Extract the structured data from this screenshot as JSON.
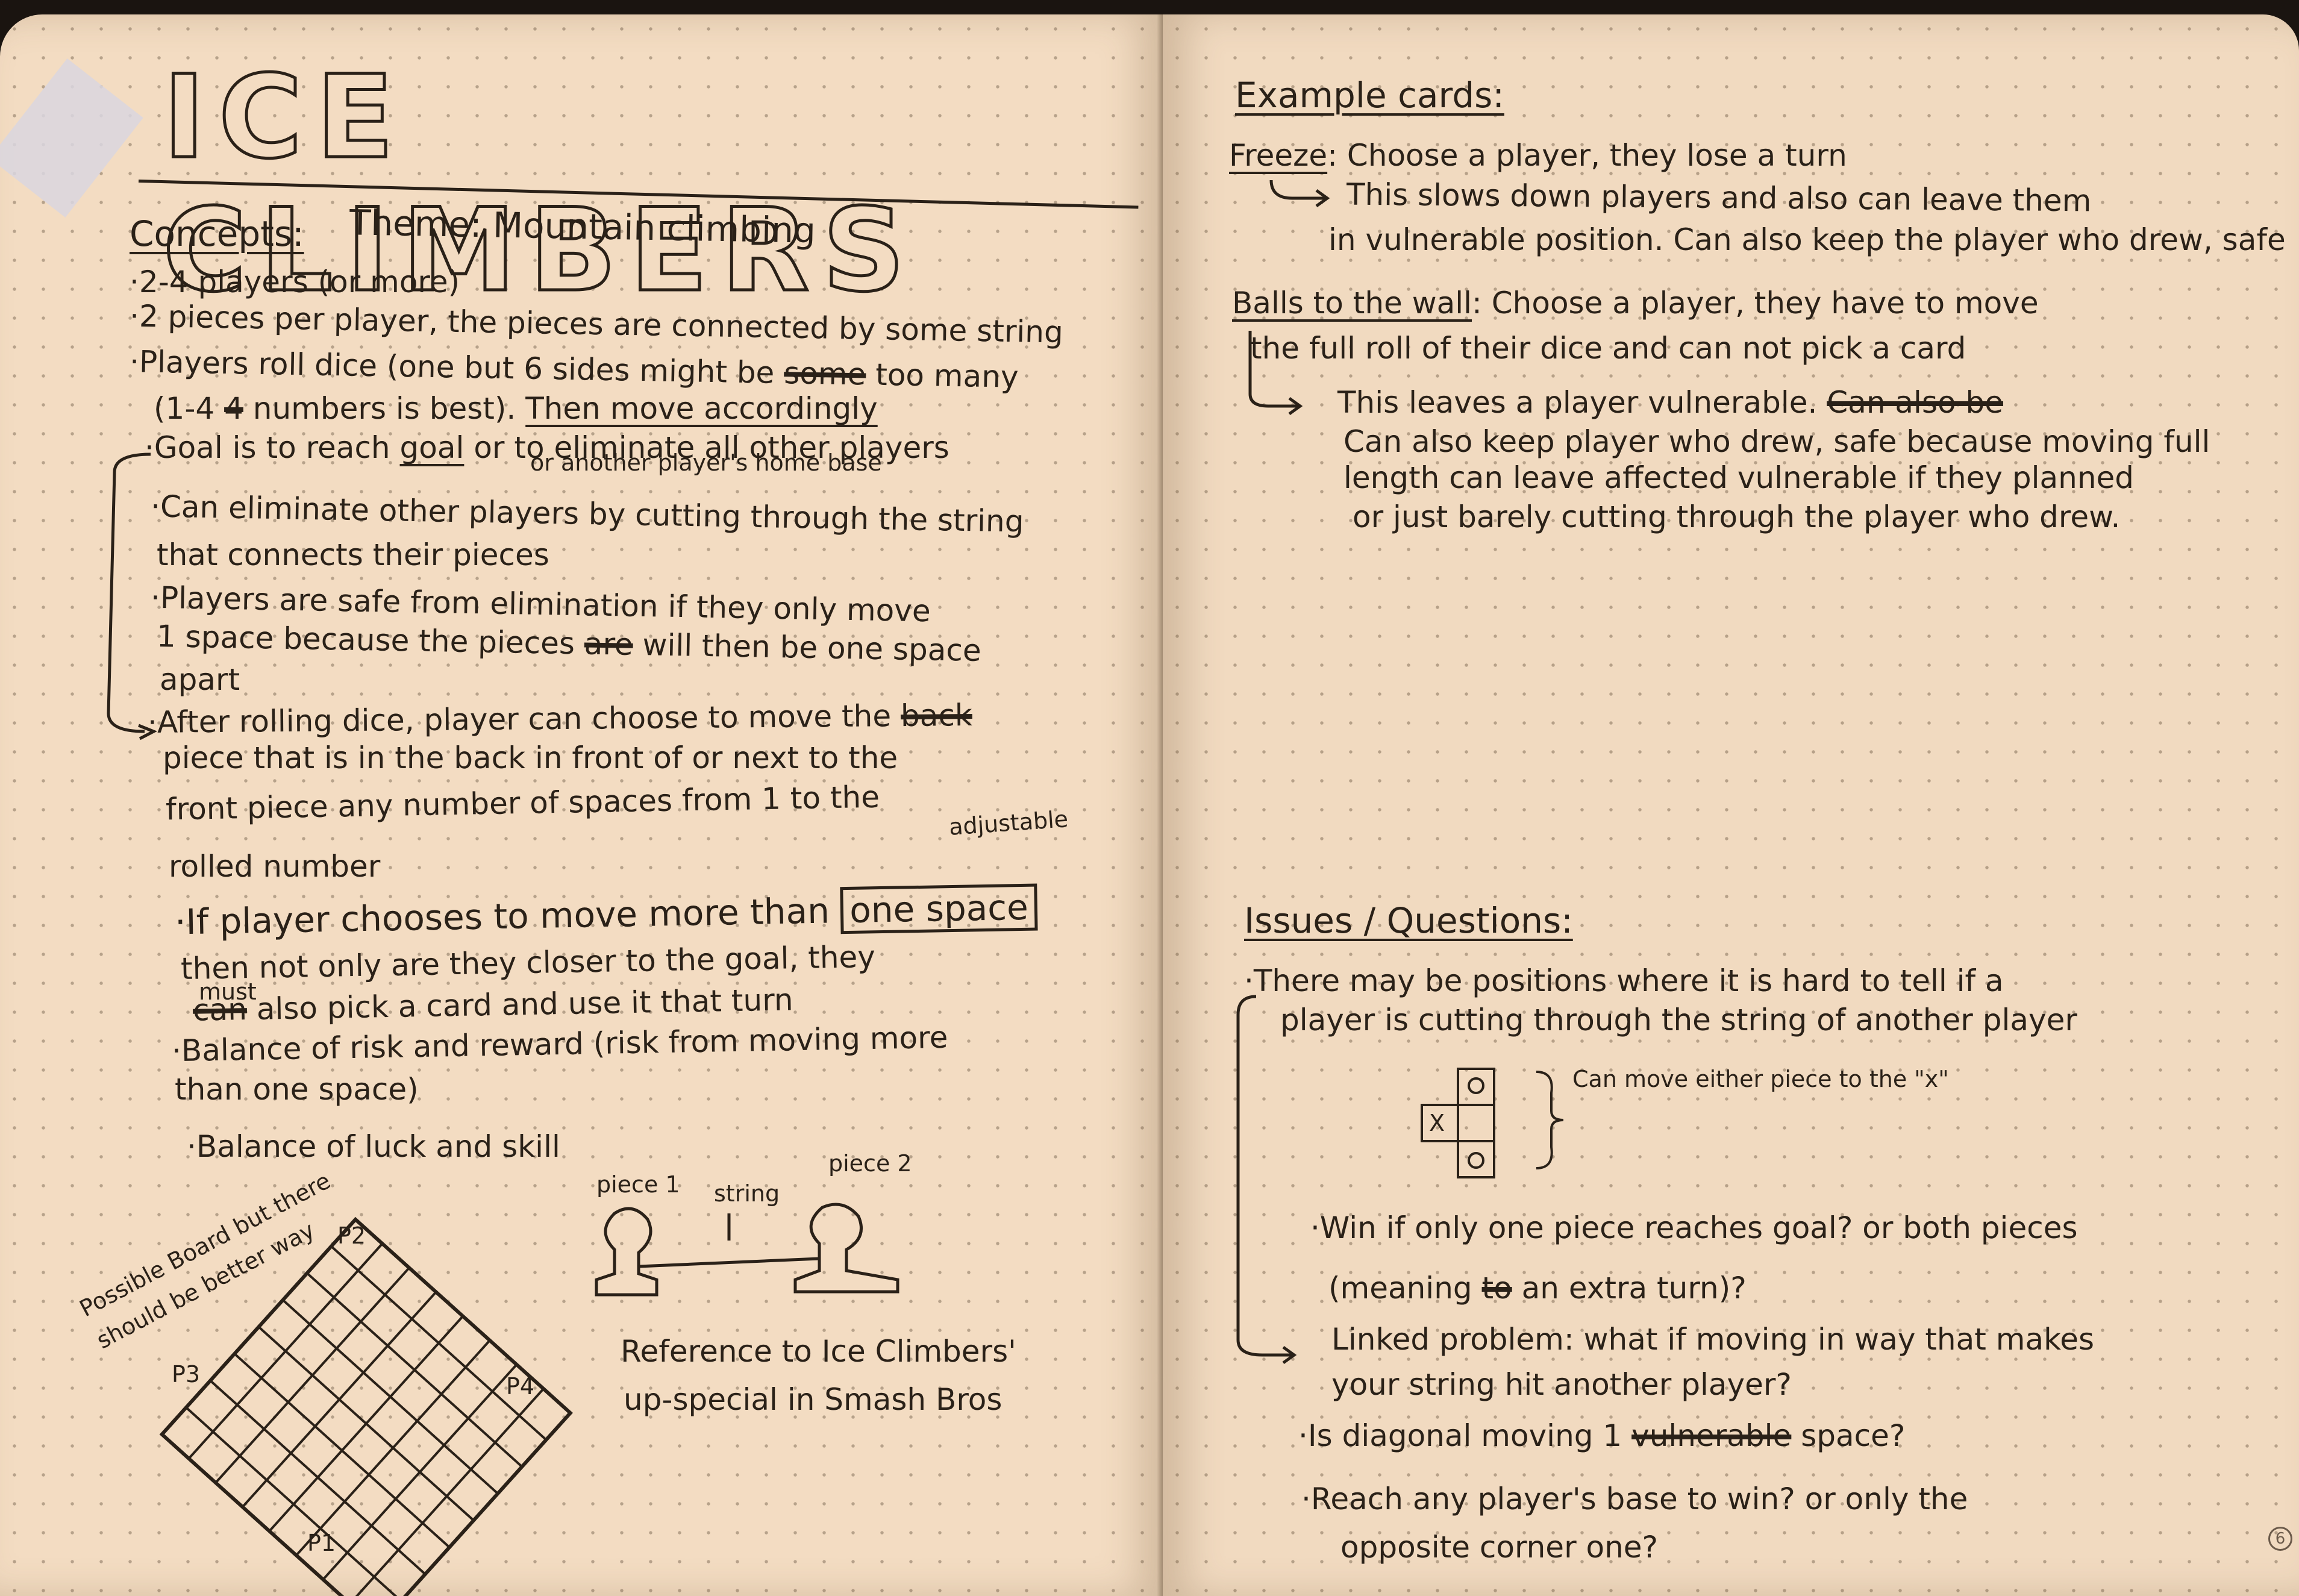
{
  "left": {
    "title": "ICE CLIMBERS",
    "concepts_label": "Concepts:",
    "theme": "Theme: Mountain climbing",
    "bullets": [
      "·2-4 players (or more)",
      "·2 pieces per player, the pieces are connected by some string",
      "·Players roll dice (one but 6 sides might be",
      "too many",
      "(1-4",
      "numbers is best).",
      "Then move accordingly",
      "·Goal is to reach",
      "goal",
      "or to eliminate all other players",
      "or another player's home base",
      "·Can eliminate other players by cutting through the string",
      "that connects their pieces",
      "·Players are safe from elimination if they only move",
      "1 space because the pieces",
      "will then be one space",
      "apart",
      "·After rolling dice, player can choose to move the",
      "piece that is in the back in front of or next to the",
      "front piece any number of spaces from 1 to the",
      "rolled number",
      "adjustable",
      "·If player chooses to move more than",
      "one space",
      "then not only are they closer to the goal, they",
      "must",
      "also pick a card and use it that turn",
      "·Balance of risk and reward (risk from moving more",
      "than one space)",
      "·Balance of luck and skill"
    ],
    "board_note": "Possible Board but there should be better way",
    "board_labels": [
      "P2",
      "P3",
      "P4",
      "P1"
    ],
    "piece_labels": {
      "piece1": "piece 1",
      "string": "string",
      "piece2": "piece 2"
    },
    "reference": [
      "Reference to Ice Climbers'",
      "up-special in Smash Bros"
    ]
  },
  "right": {
    "example_heading": "Example cards:",
    "freeze_title": "Freeze",
    "freeze_desc": ": Choose a player, they lose a turn",
    "freeze_note": [
      "This slows down players and also can leave them",
      "in vulnerable position. Can also keep the player who drew, safe"
    ],
    "walls_title": "Balls to the wall",
    "walls_desc": ": Choose a player, they have to move",
    "walls_desc2": "the full roll of their dice and can not pick a card",
    "walls_note": [
      "This leaves a player vulnerable.",
      "Can also keep player who drew, safe because moving full",
      "length can leave affected vulnerable if they planned",
      "or just barely cutting through the player who drew."
    ],
    "issues_heading": "Issues / Questions:",
    "issues": [
      "·There may be positions where it is hard to tell if a",
      "player is cutting through the string of another player",
      "Can move either piece to the \"x\"",
      "·Win if only one piece reaches goal? or both pieces",
      "(meaning",
      "an extra turn)?",
      "Linked problem: what if moving in way that makes",
      "your string hit another player?",
      "·Is diagonal moving 1",
      "space?",
      "·Reach any player's base to win? or only the",
      "opposite corner one?"
    ],
    "grid_mark": "X",
    "page_number": "6"
  }
}
